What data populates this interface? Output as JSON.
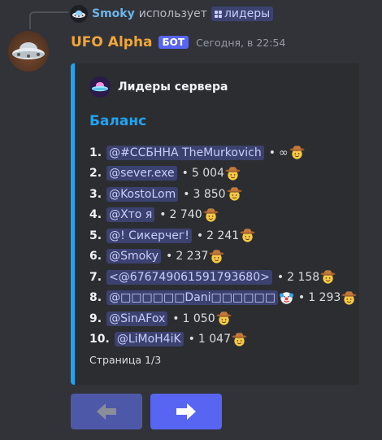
{
  "reply": {
    "user": "Smoky",
    "action_text": "использует",
    "command": "лидеры"
  },
  "message": {
    "author": "UFO Alpha",
    "bot_tag": "БОТ",
    "timestamp": "Сегодня, в 22:54"
  },
  "embed": {
    "accent_color": "#1fa4f3",
    "author_name": "Лидеры сервера",
    "title": "Баланс",
    "footer": "Страница 1/3",
    "rows": [
      {
        "rank": "1.",
        "name": "@#ССБННА TheMurkovich",
        "sep": "•",
        "value": "∞",
        "icon": "cowboy-emoji"
      },
      {
        "rank": "2.",
        "name": "@sever.exe",
        "sep": "•",
        "value": "5 004",
        "icon": "cowboy-emoji"
      },
      {
        "rank": "3.",
        "name": "@KostoLom",
        "sep": "•",
        "value": "3 850",
        "icon": "cowboy-emoji"
      },
      {
        "rank": "4.",
        "name": "@Хто я",
        "sep": "•",
        "value": "2 740",
        "icon": "cowboy-emoji"
      },
      {
        "rank": "5.",
        "name": "@! Сикерчег!",
        "sep": "•",
        "value": "2 241",
        "icon": "cowboy-emoji"
      },
      {
        "rank": "6.",
        "name": "@Smoky",
        "sep": "•",
        "value": "2 237",
        "icon": "cowboy-emoji"
      },
      {
        "rank": "7.",
        "name": "<@676749061591793680>",
        "sep": "•",
        "value": "2 158",
        "icon": "cowboy-emoji"
      },
      {
        "rank": "8.",
        "name": "@□□□□□□Dani□□□□□□",
        "sep": "•",
        "value": "1 293",
        "icon": "cowboy-emoji",
        "extra_icon": "clown-emoji"
      },
      {
        "rank": "9.",
        "name": "@SinAFox",
        "sep": "•",
        "value": "1 050",
        "icon": "cowboy-emoji"
      },
      {
        "rank": "10.",
        "name": "@LiMoH4iK",
        "sep": "•",
        "value": "1 047",
        "icon": "cowboy-emoji"
      }
    ]
  },
  "buttons": {
    "prev_icon": "arrow-left-icon",
    "next_icon": "arrow-right-icon"
  },
  "colors": {
    "background": "#313338",
    "embed_bg": "#2b2d31",
    "author_color": "#f0a63a",
    "bot_tag": "#5865f2",
    "mention_bg": "#3c4270",
    "button_primary": "#5865f2"
  }
}
